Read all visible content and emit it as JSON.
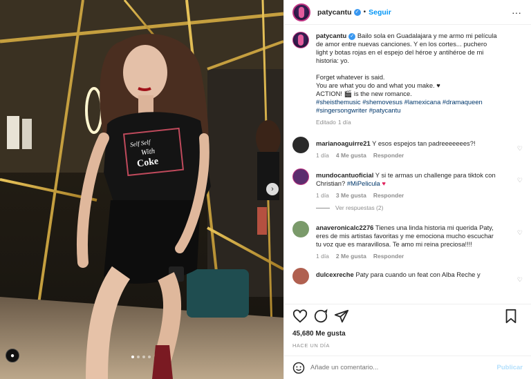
{
  "post": {
    "username": "patycantu",
    "follow_label": "Seguir",
    "separator": "•",
    "more_label": "···",
    "caption_lines": [
      "Bailo sola en Guadalajara y me armo mi película",
      "de amor entre nuevas canciones. Y en los cortes... puchero",
      "light y botas rojas en el espejo del héroe y antihéroe de mi",
      "historia: yo.",
      "",
      "Forget whatever is said.",
      "You are what you do and what you make. ♥",
      "ACTION! 🎬 is the new romance."
    ],
    "hashtags_line1": "#sheisthemusic #shemovesus #lamexicana #dramaqueen",
    "hashtags_line2": "#singersongwriter #patycantu",
    "edited_label": "Editado",
    "edited_time": "1 día"
  },
  "comments": [
    {
      "user": "marianoaguirre21",
      "text": "Y esos espejos tan padreeeeeees?!",
      "time": "1 día",
      "likes": "4 Me gusta",
      "reply": "Responder",
      "avatar_color": "#2a2a2a"
    },
    {
      "user": "mundocantuoficial",
      "text_line1": "Y si te armas un challenge para tiktok con",
      "text_line2_plain": "Christian? ",
      "text_line2_tag": "#MiPelicula",
      "text_line2_emoji": "♥",
      "time": "1 día",
      "likes": "3 Me gusta",
      "reply": "Responder",
      "view_replies": "Ver respuestas (2)",
      "avatar_color": "#5c2e6e"
    },
    {
      "user": "anaveronicalc2276",
      "text_lines": [
        "Tienes una linda historia mi querida Paty,",
        "eres de mis artistas favoritas y me emociona mucho escuchar",
        "tu voz que es maravillosa. Te amo mi reina preciosa!!!!"
      ],
      "time": "1 día",
      "likes": "2 Me gusta",
      "reply": "Responder",
      "avatar_color": "#7a9a6a"
    },
    {
      "user": "dulcexreche",
      "text_line1": "Paty para cuando un feat con Alba Reche y",
      "avatar_color": "#b06050"
    }
  ],
  "actions": {
    "likes": "45,680 Me gusta",
    "date": "HACE UN DÍA"
  },
  "composer": {
    "placeholder": "Añade un comentario...",
    "publish_label": "Publicar"
  },
  "photo": {
    "shirt_text_1": "Self Self",
    "shirt_text_2": "With",
    "shirt_text_3": "Coke"
  }
}
